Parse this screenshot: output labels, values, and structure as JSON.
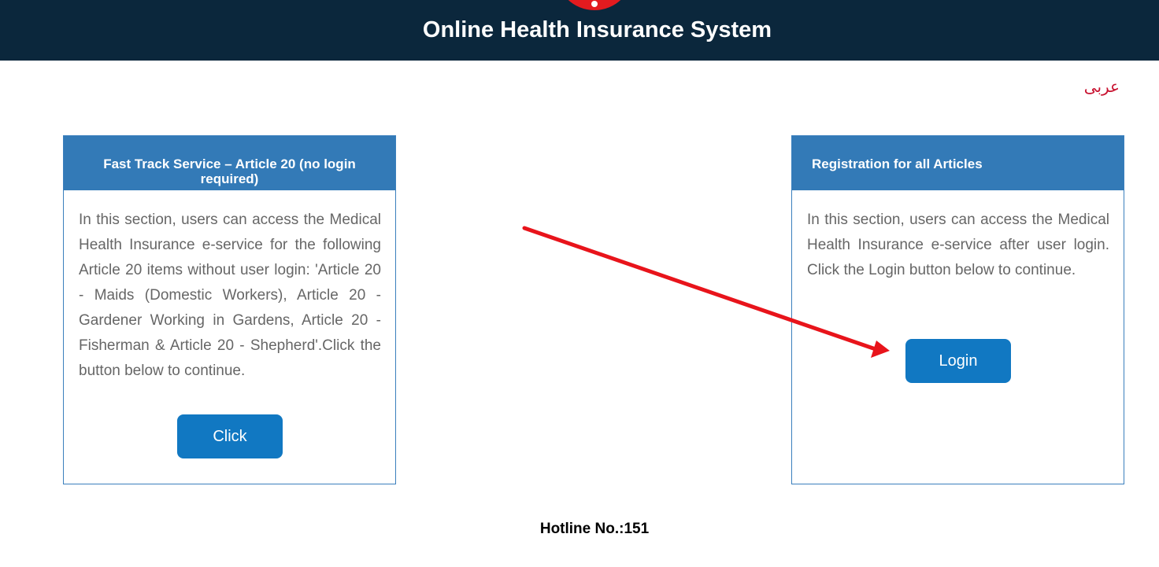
{
  "header": {
    "title": "Online Health Insurance System"
  },
  "language": {
    "link_label": "عربى"
  },
  "fast_track": {
    "title": "Fast Track Service – Article 20 (no login required)",
    "description": "In this section, users can access the Medical Health Insurance e-service for the following Article 20 items without user login: 'Article 20 - Maids (Domestic Workers), Article 20 - Gardener Working in Gardens, Article 20 - Fisherman & Article 20 - Shepherd'.Click the button below to continue.",
    "button_label": "Click"
  },
  "registration": {
    "title": "Registration for all Articles",
    "description": "In this section, users can access the Medical Health Insurance e-service after user login. Click the Login button below to continue.",
    "button_label": "Login"
  },
  "footer": {
    "hotline": "Hotline No.:151"
  },
  "colors": {
    "header_bg": "#0b273c",
    "card_header_bg": "#337ab7",
    "button_bg": "#1178c2",
    "language_link": "#c8102e",
    "annotation_arrow": "#e8141b",
    "logo": "#e31b1f"
  },
  "icons": {
    "logo": "logo-emblem-icon",
    "annotation": "red-arrow-annotation"
  }
}
